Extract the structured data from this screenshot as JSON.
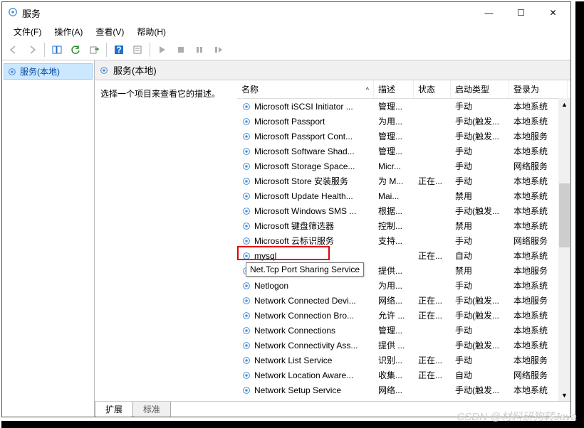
{
  "window": {
    "title": "服务",
    "min": "—",
    "max": "☐",
    "close": "✕"
  },
  "menu": {
    "file": "文件(F)",
    "action": "操作(A)",
    "view": "查看(V)",
    "help": "帮助(H)"
  },
  "tree": {
    "root": "服务(本地)"
  },
  "header": {
    "title": "服务(本地)"
  },
  "detail": {
    "prompt": "选择一个项目来查看它的描述。"
  },
  "columns": {
    "name": "名称",
    "desc": "描述",
    "status": "状态",
    "startup": "启动类型",
    "logon": "登录为"
  },
  "sort_indicator": "^",
  "services": [
    {
      "name": "Microsoft iSCSI Initiator ...",
      "desc": "管理...",
      "status": "",
      "startup": "手动",
      "logon": "本地系统"
    },
    {
      "name": "Microsoft Passport",
      "desc": "为用...",
      "status": "",
      "startup": "手动(触发...",
      "logon": "本地系统"
    },
    {
      "name": "Microsoft Passport Cont...",
      "desc": "管理...",
      "status": "",
      "startup": "手动(触发...",
      "logon": "本地服务"
    },
    {
      "name": "Microsoft Software Shad...",
      "desc": "管理...",
      "status": "",
      "startup": "手动",
      "logon": "本地系统"
    },
    {
      "name": "Microsoft Storage Space...",
      "desc": "Micr...",
      "status": "",
      "startup": "手动",
      "logon": "网络服务"
    },
    {
      "name": "Microsoft Store 安装服务",
      "desc": "为 M...",
      "status": "正在...",
      "startup": "手动",
      "logon": "本地系统"
    },
    {
      "name": "Microsoft Update Health...",
      "desc": "Mai...",
      "status": "",
      "startup": "禁用",
      "logon": "本地系统"
    },
    {
      "name": "Microsoft Windows SMS ...",
      "desc": "根据...",
      "status": "",
      "startup": "手动(触发...",
      "logon": "本地系统"
    },
    {
      "name": "Microsoft 键盘筛选器",
      "desc": "控制...",
      "status": "",
      "startup": "禁用",
      "logon": "本地系统"
    },
    {
      "name": "Microsoft 云标识服务",
      "desc": "支持...",
      "status": "",
      "startup": "手动",
      "logon": "网络服务"
    },
    {
      "name": "mysql",
      "desc": "",
      "status": "正在...",
      "startup": "自动",
      "logon": "本地系统"
    },
    {
      "name": "Net.Tcp Port Sharing Ser...",
      "desc": "提供...",
      "status": "",
      "startup": "禁用",
      "logon": "本地服务"
    },
    {
      "name": "Netlogon",
      "desc": "为用...",
      "status": "",
      "startup": "手动",
      "logon": "本地系统"
    },
    {
      "name": "Network Connected Devi...",
      "desc": "网络...",
      "status": "正在...",
      "startup": "手动(触发...",
      "logon": "本地服务"
    },
    {
      "name": "Network Connection Bro...",
      "desc": "允许 ...",
      "status": "正在...",
      "startup": "手动(触发...",
      "logon": "本地系统"
    },
    {
      "name": "Network Connections",
      "desc": "管理...",
      "status": "",
      "startup": "手动",
      "logon": "本地系统"
    },
    {
      "name": "Network Connectivity Ass...",
      "desc": "提供 ...",
      "status": "",
      "startup": "手动(触发...",
      "logon": "本地系统"
    },
    {
      "name": "Network List Service",
      "desc": "识别...",
      "status": "正在...",
      "startup": "手动",
      "logon": "本地服务"
    },
    {
      "name": "Network Location Aware...",
      "desc": "收集...",
      "status": "正在...",
      "startup": "自动",
      "logon": "网络服务"
    },
    {
      "name": "Network Setup Service",
      "desc": "网络...",
      "status": "",
      "startup": "手动(触发...",
      "logon": "本地系统"
    }
  ],
  "tabs": {
    "ext": "扩展",
    "std": "标准"
  },
  "tooltip": "Net.Tcp Port Sharing Service",
  "watermark": "CSDN @材料研狗转Java"
}
